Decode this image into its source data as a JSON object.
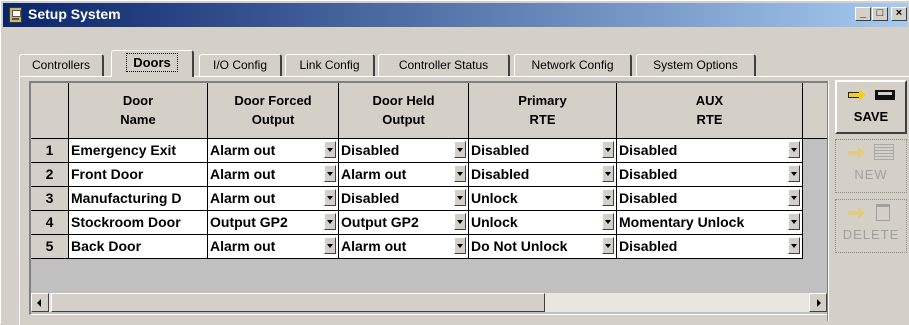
{
  "window": {
    "title": "Setup System",
    "buttons": {
      "minimize": "_",
      "maximize": "□",
      "close": "×"
    }
  },
  "tabs": [
    {
      "label": "Controllers",
      "active": false
    },
    {
      "label": "Doors",
      "active": true
    },
    {
      "label": "I/O Config",
      "active": false
    },
    {
      "label": "Link Config",
      "active": false
    },
    {
      "label": "Controller Status",
      "active": false
    },
    {
      "label": "Network Config",
      "active": false
    },
    {
      "label": "System Options",
      "active": false
    }
  ],
  "grid": {
    "columns": [
      {
        "line1": "Door",
        "line2": "Name"
      },
      {
        "line1": "Door Forced",
        "line2": "Output"
      },
      {
        "line1": "Door Held",
        "line2": "Output"
      },
      {
        "line1": "Primary",
        "line2": "RTE"
      },
      {
        "line1": "AUX",
        "line2": "RTE"
      }
    ],
    "rows": [
      {
        "num": "1",
        "name": "Emergency Exit",
        "forced": "Alarm out",
        "held": "Disabled",
        "primary": "Disabled",
        "aux": "Disabled"
      },
      {
        "num": "2",
        "name": "Front Door",
        "forced": "Alarm out",
        "held": "Alarm out",
        "primary": "Disabled",
        "aux": "Disabled"
      },
      {
        "num": "3",
        "name": "Manufacturing D",
        "forced": "Alarm out",
        "held": "Disabled",
        "primary": "Unlock",
        "aux": "Disabled"
      },
      {
        "num": "4",
        "name": "Stockroom Door",
        "forced": "Output GP2",
        "held": "Output GP2",
        "primary": "Unlock",
        "aux": "Momentary Unlock"
      },
      {
        "num": "5",
        "name": "Back Door",
        "forced": "Alarm out",
        "held": "Alarm out",
        "primary": "Do Not Unlock",
        "aux": "Disabled"
      }
    ]
  },
  "toolbar": {
    "save_label": "SAVE",
    "new_label": "NEW",
    "delete_label": "DELETE",
    "save_enabled": true,
    "new_enabled": false,
    "delete_enabled": false
  },
  "icons": {
    "title": "app-icon",
    "save": "arrow-disk-icon",
    "new": "arrow-new-icon",
    "delete": "arrow-trash-icon"
  },
  "colors": {
    "titlebar_start": "#0a246a",
    "titlebar_end": "#a6caf0",
    "face": "#d4d0c8",
    "arrow": "#f2d020"
  }
}
